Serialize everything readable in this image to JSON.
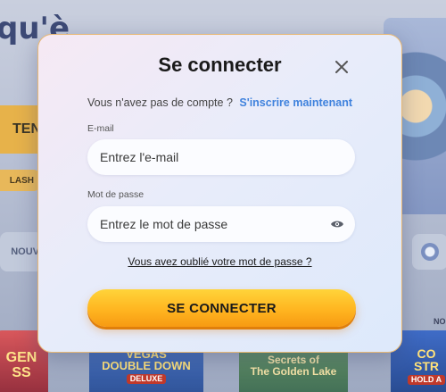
{
  "background": {
    "hero_text": "qu'è",
    "cta_fragment": "TEN",
    "chip_fragment": "LASH",
    "nouv_left": "NOUV",
    "nouv_right": "NO",
    "games": [
      {
        "line1": "GEN",
        "line2": "SS",
        "sub": ""
      },
      {
        "line1": "VEGAS",
        "line2": "DOUBLE DOWN",
        "sub": "DELUXE"
      },
      {
        "line1": "Secrets of",
        "line2": "The Golden Lake",
        "sub": ""
      },
      {
        "line1": "CO",
        "line2": "STR",
        "sub": "HOLD A"
      }
    ]
  },
  "modal": {
    "title": "Se connecter",
    "no_account_text": "Vous n'avez pas de compte ?",
    "register_link": "S'inscrire maintenant",
    "email_label": "E-mail",
    "email_placeholder": "Entrez l'e-mail",
    "email_value": "",
    "password_label": "Mot de passe",
    "password_placeholder": "Entrez le mot de passe",
    "password_value": "",
    "forgot_link": "Vous avez oublié votre mot de passe ?",
    "submit_label": "SE CONNECTER"
  },
  "icons": {
    "close": "close-icon",
    "eye": "eye-icon"
  },
  "colors": {
    "link": "#3f82dd",
    "button_top": "#ffd43a",
    "button_bottom": "#f79a12",
    "modal_border": "#e8b874"
  }
}
